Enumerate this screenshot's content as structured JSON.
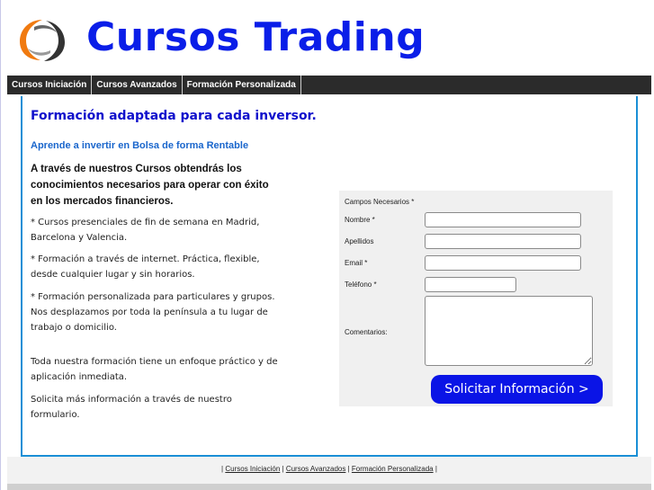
{
  "header": {
    "title": "Cursos Trading",
    "logo_icon": "swirl-logo-icon",
    "title_color": "#0a1ee8"
  },
  "nav": {
    "items": [
      {
        "label": "Cursos Iniciación"
      },
      {
        "label": "Cursos Avanzados"
      },
      {
        "label": "Formación Personalizada"
      }
    ]
  },
  "main": {
    "headline": "Formación adaptada para cada inversor.",
    "subhead": "Aprende a invertir en Bolsa de forma Rentable",
    "lead": "A través de nuestros Cursos obtendrás los conocimientos necesarios para operar con éxito en los mercados financieros.",
    "paragraphs": [
      "* Cursos presenciales de fin de semana en Madrid, Barcelona y Valencia.",
      "* Formación a través de internet. Práctica, flexible, desde cualquier lugar y sin horarios.",
      "* Formación personalizada para particulares y grupos. Nos desplazamos por toda la península a tu lugar de trabajo o domicilio.",
      "Toda nuestra formación tiene un enfoque práctico y de aplicación inmediata.",
      "Solicita más información a través de nuestro formulario."
    ]
  },
  "form": {
    "note": "Campos Necesarios *",
    "fields": [
      {
        "label": "Nombre *",
        "value": ""
      },
      {
        "label": "Apellidos",
        "value": ""
      },
      {
        "label": "Email *",
        "value": ""
      },
      {
        "label": "Teléfono *",
        "value": ""
      }
    ],
    "comments_label": "Comentarios:",
    "comments_value": "",
    "submit_label": "Solicitar Información >",
    "submit_color": "#0a14e6"
  },
  "footer": {
    "links": [
      {
        "label": "Cursos Iniciación"
      },
      {
        "label": "Cursos Avanzados"
      },
      {
        "label": "Formación Personalizada"
      }
    ]
  },
  "colors": {
    "accent_border": "#1a8fd6",
    "nav_bg": "#2b2b2b",
    "headline": "#1010cc",
    "subhead": "#1a66cc"
  }
}
